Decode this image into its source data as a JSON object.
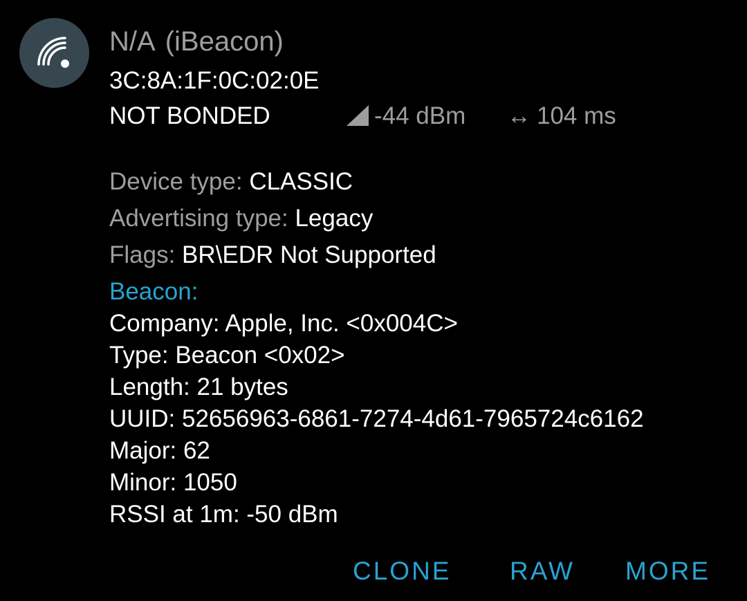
{
  "device": {
    "name": "N/A",
    "type_tag": "(iBeacon)",
    "address": "3C:8A:1F:0C:02:0E",
    "bond_state": "NOT BONDED",
    "rssi": "-44 dBm",
    "interval": "104 ms",
    "icon": "beacon-signal-icon",
    "rssi_icon": "signal-strength-icon",
    "interval_icon": "left-right-arrow-icon"
  },
  "details": {
    "device_type_label": "Device type: ",
    "device_type_value": "CLASSIC",
    "adv_type_label": "Advertising type: ",
    "adv_type_value": "Legacy",
    "flags_label": "Flags: ",
    "flags_value": "BR\\EDR Not Supported"
  },
  "beacon": {
    "header": "Beacon:",
    "company": "Company: Apple, Inc. <0x004C>",
    "type": "Type: Beacon <0x02>",
    "length": "Length: 21 bytes",
    "uuid": "UUID: 52656963-6861-7274-4d61-7965724c6162",
    "major": "Major: 62",
    "minor": "Minor: 1050",
    "rssi_1m": "RSSI at 1m: -50 dBm"
  },
  "actions": {
    "clone": "CLONE",
    "raw": "RAW",
    "more": "MORE"
  },
  "colors": {
    "background": "#000000",
    "avatar": "#37474f",
    "accent": "#29a3d1",
    "secondary_text": "#9e9e9e",
    "primary_text": "#ffffff"
  }
}
